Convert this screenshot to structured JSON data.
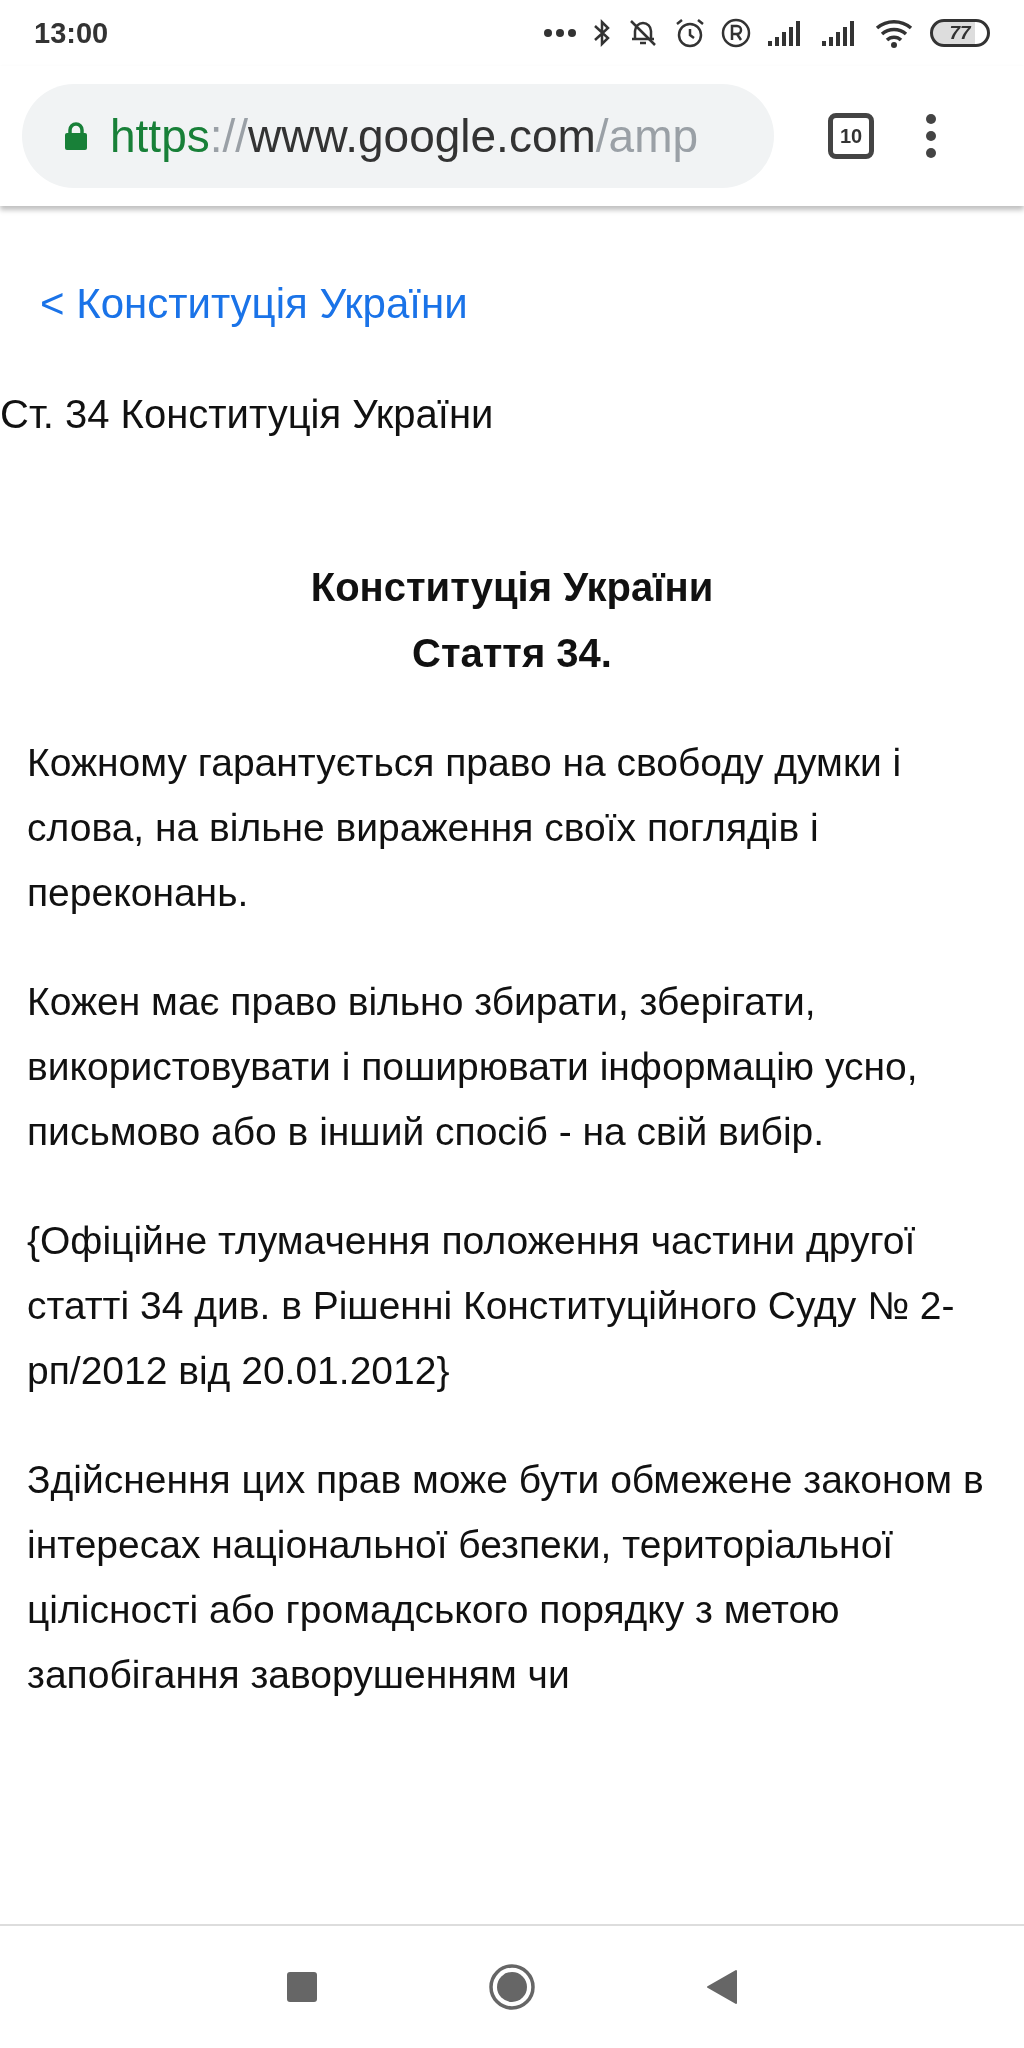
{
  "status_bar": {
    "time": "13:00",
    "battery": "77"
  },
  "browser": {
    "url_scheme": "https",
    "url_separator": "://",
    "url_host": "www.google.com",
    "url_rest": "/amp",
    "tab_count": "10"
  },
  "page": {
    "back_link": "< Конституція України",
    "heading": "Ст. 34 Конституція України",
    "title_lines": [
      "Конституція України",
      "Стаття 34."
    ],
    "paragraphs": [
      "Кожному гарантується право на свободу думки і слова, на вільне вираження своїх поглядів і переконань.",
      "Кожен має право вільно збирати, зберігати, використовувати і поширювати інформацію усно, письмово або в інший спосіб - на свій вибір.",
      "{Офіційне тлумачення положення частини другої статті 34 див. в Рішенні Конституційного Суду № 2-рп/2012 від 20.01.2012}",
      "Здійснення цих прав може бути обмежене законом в інтересах національної безпеки, територіальної цілісності або громадського порядку з метою запобігання заворушенням чи"
    ]
  }
}
